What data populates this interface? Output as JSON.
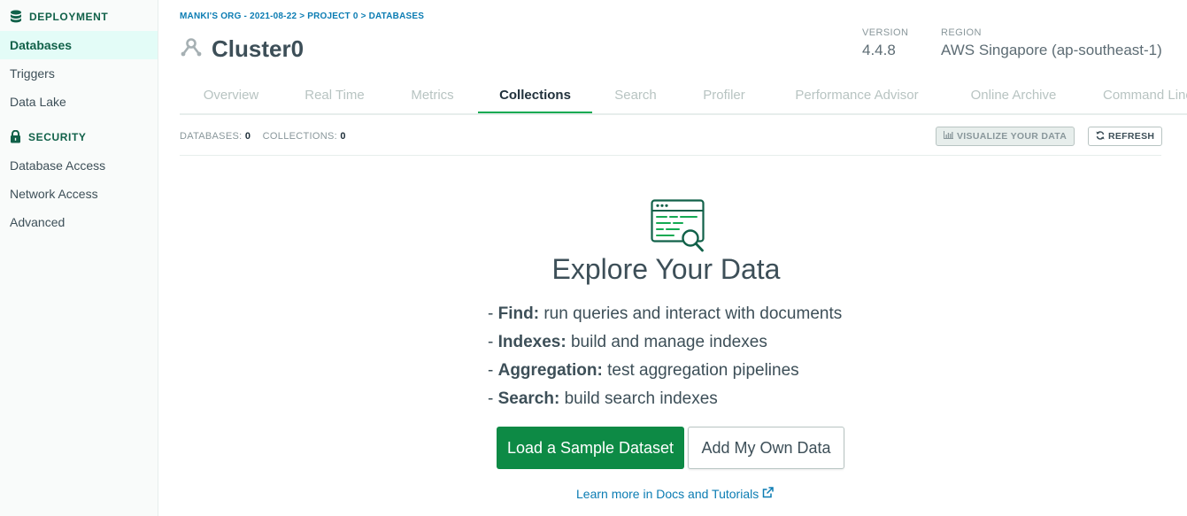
{
  "colors": {
    "accent_green": "#13aa52",
    "brand_dark_green": "#116149",
    "link_blue": "#0b7cb3"
  },
  "sidebar": {
    "deployment_heading": "DEPLOYMENT",
    "deployment_items": [
      {
        "label": "Databases",
        "active": true
      },
      {
        "label": "Triggers"
      },
      {
        "label": "Data Lake"
      }
    ],
    "security_heading": "SECURITY",
    "security_items": [
      {
        "label": "Database Access"
      },
      {
        "label": "Network Access"
      },
      {
        "label": "Advanced"
      }
    ]
  },
  "header": {
    "breadcrumb": "MANKI'S ORG - 2021-08-22 > PROJECT 0 > DATABASES",
    "cluster_name": "Cluster0",
    "version_label": "VERSION",
    "version_value": "4.4.8",
    "region_label": "REGION",
    "region_value": "AWS Singapore (ap-southeast-1)"
  },
  "tabs": [
    {
      "label": "Overview"
    },
    {
      "label": "Real Time"
    },
    {
      "label": "Metrics"
    },
    {
      "label": "Collections",
      "active": true
    },
    {
      "label": "Search"
    },
    {
      "label": "Profiler"
    },
    {
      "label": "Performance Advisor"
    },
    {
      "label": "Online Archive"
    },
    {
      "label": "Command Line Tools"
    }
  ],
  "toolbar": {
    "databases_label": "DATABASES:",
    "databases_count": "0",
    "collections_label": "COLLECTIONS:",
    "collections_count": "0",
    "visualize_label": "VISUALIZE YOUR DATA",
    "refresh_label": "REFRESH"
  },
  "empty_state": {
    "heading": "Explore Your Data",
    "features": [
      {
        "name": "Find:",
        "desc": "run queries and interact with documents"
      },
      {
        "name": "Indexes:",
        "desc": "build and manage indexes"
      },
      {
        "name": "Aggregation:",
        "desc": "test aggregation pipelines"
      },
      {
        "name": "Search:",
        "desc": "build search indexes"
      }
    ],
    "primary_button": "Load a Sample Dataset",
    "secondary_button": "Add My Own Data",
    "learn_link": "Learn more in Docs and Tutorials"
  }
}
